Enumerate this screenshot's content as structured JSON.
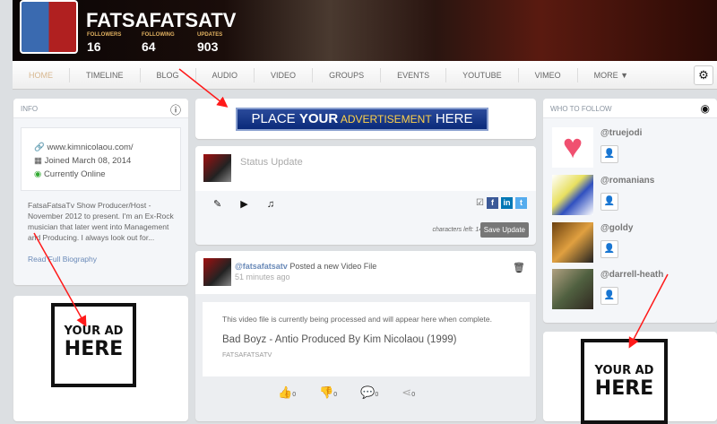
{
  "profile": {
    "name": "FATSAFATSATV",
    "stats": [
      {
        "label": "FOLLOWERS",
        "value": "16"
      },
      {
        "label": "FOLLOWING",
        "value": "64"
      },
      {
        "label": "UPDATES",
        "value": "903"
      }
    ]
  },
  "nav": {
    "items": [
      "HOME",
      "TIMELINE",
      "BLOG",
      "AUDIO",
      "VIDEO",
      "GROUPS",
      "EVENTS",
      "YOUTUBE",
      "VIMEO",
      "MORE ▼"
    ]
  },
  "info": {
    "title": "INFO",
    "website": "www.kimnicolaou.com/",
    "joined": "Joined March 08, 2014",
    "status": "Currently Online",
    "bio": "FatsaFatsaTv Show Producer/Host - November 2012 to present.  I'm an Ex-Rock musician that later went into Management and Producing. I always look out for...",
    "read_more": "Read Full Biography"
  },
  "ads": {
    "top": {
      "a": "PLACE ",
      "b": "YOUR",
      "c": " ADVERTISEMENT",
      "d": " HERE"
    },
    "box_line1": "YOUR AD",
    "box_line2": "HERE"
  },
  "status": {
    "placeholder": "Status Update",
    "chars_left": "characters left: 140",
    "save": "Save Update"
  },
  "post": {
    "user": "@fatsafatsatv",
    "action": " Posted a new Video File",
    "time": "51 minutes ago",
    "notice": "This video file is currently being processed and will appear here when complete.",
    "title": "Bad Boyz - Antio Produced By Kim Nicolaou (1999)",
    "owner": "FATSAFATSATV",
    "likes": "0",
    "dislikes": "0",
    "comments": "0",
    "shares": "0"
  },
  "follow": {
    "title": "WHO TO FOLLOW",
    "users": [
      "@truejodi",
      "@romanians",
      "@goldy",
      "@darrell-heath"
    ]
  },
  "colors": {
    "annotation": "#ff1a1a",
    "link": "#6a8ab8"
  }
}
